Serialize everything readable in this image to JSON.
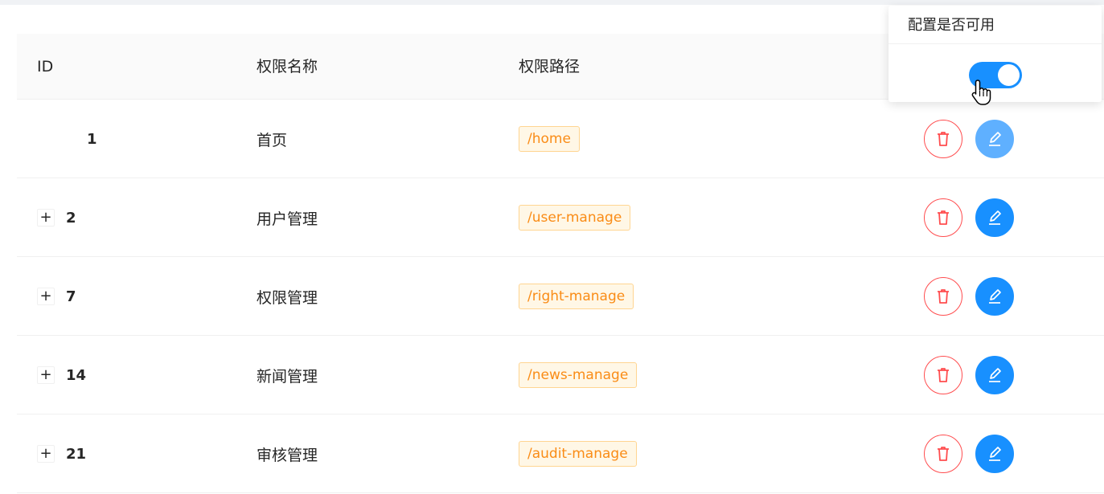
{
  "table": {
    "columns": {
      "id": "ID",
      "name": "权限名称",
      "path": "权限路径"
    },
    "rows": [
      {
        "id": "1",
        "expandable": false,
        "name": "首页",
        "path": "/home"
      },
      {
        "id": "2",
        "expandable": true,
        "name": "用户管理",
        "path": "/user-manage"
      },
      {
        "id": "7",
        "expandable": true,
        "name": "权限管理",
        "path": "/right-manage"
      },
      {
        "id": "14",
        "expandable": true,
        "name": "新闻管理",
        "path": "/news-manage"
      },
      {
        "id": "21",
        "expandable": true,
        "name": "审核管理",
        "path": "/audit-manage"
      }
    ],
    "expand_symbol": "+"
  },
  "popover": {
    "title": "配置是否可用",
    "switch_on": true
  },
  "icons": {
    "delete": "trash-icon",
    "edit": "pencil-icon",
    "cursor": "hand-pointer-icon"
  },
  "colors": {
    "primary": "#1890ff",
    "danger": "#ff4d4f",
    "tag_text": "#fa8c16",
    "tag_bg": "#fff7e6",
    "tag_border": "#ffd591"
  }
}
